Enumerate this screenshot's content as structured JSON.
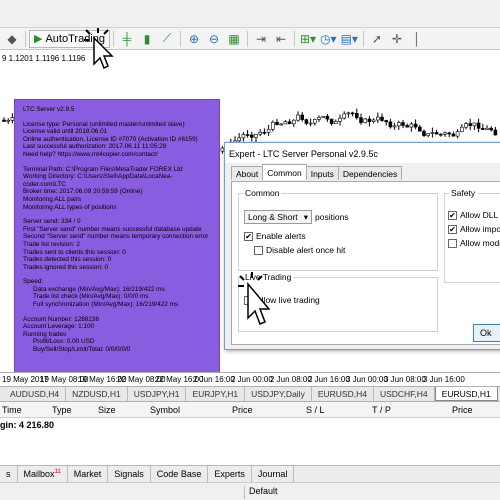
{
  "toolbar": {
    "autotrading_label": "AutoTrading",
    "icons": [
      "chart-icon",
      "autotrading-icon",
      "bar-chart-icon",
      "candle-chart-icon",
      "line-chart-icon",
      "zoom-in-icon",
      "zoom-out-icon",
      "tile-icon",
      "scroll-icon",
      "shift-icon",
      "indicators-icon",
      "periods-icon",
      "templates-icon",
      "crosshair-icon",
      "cursor-icon",
      "vertical-line-icon"
    ]
  },
  "chart": {
    "info_text": "9 1.1201 1.1196 1.1196",
    "candle_color": "#000000"
  },
  "ltc_box": {
    "background": "#8a5ce0",
    "lines": [
      "LTC Server v2.9.5",
      "",
      "License type: Personal (unlimited master/unlimited slave)",
      "License valid until 2018.06.01",
      "Online authentication. License ID #7070 (Activation ID #6159)",
      "Last successful authorization: 2017.06.11 11:05:28",
      "Need help? https://www.mt4copier.com/contact/",
      "",
      "Terminal Path: C:\\Program Files\\MetaTrader FOREX Ltd",
      "Working Directory: C:\\Users\\Steli\\AppData\\Local\\lea-coder.com\\LTC",
      "Broker time: 2017.06.09 20:59:59 (Online)",
      "Monitoring ALL pairs",
      "Monitoring ALL types of positions",
      "",
      "Server send: 334 / 0",
      "First \"Server send\" number means successful database update",
      "Second \"Server send\" number means temporary connection error",
      "Trade list revision: 2",
      "Trades sent to clients this session: 0",
      "Trades detected this session: 0",
      "Trades ignored this session: 0",
      "",
      "Speed:",
      "Data exchange (Min/Avg/Max): 16/219/422 ms",
      "Trade list check (Min/Avg/Max): 0/0/0 ms",
      "Full synchronization (Min/Avg/Max): 16/219/422 ms",
      "",
      "Account Number: 1288236",
      "Account Leverage: 1:100",
      "Running trades",
      "Profit/Loss: 0.00 USD",
      "Buy/Sell/Stop/Limit/Total: 0/0/0/0/0"
    ]
  },
  "time_axis": [
    "19 May 2017",
    "19 May 08:00",
    "19 May 16:00",
    "22 May 08:00",
    "22 May 16:00",
    "2 Jun 16:00",
    "2 Jun 00:00",
    "2 Jun 08:00",
    "2 Jun 16:00",
    "3 Jun 00:00",
    "3 Jun 08:00",
    "3 Jun 16:00"
  ],
  "chart_tabs": [
    {
      "label": "AUDUSD,H4",
      "active": false
    },
    {
      "label": "NZDUSD,H1",
      "active": false
    },
    {
      "label": "USDJPY,H1",
      "active": false
    },
    {
      "label": "EURJPY,H1",
      "active": false
    },
    {
      "label": "USDJPY,Daily",
      "active": false
    },
    {
      "label": "EURUSD,H4",
      "active": false
    },
    {
      "label": "USDCHF,H4",
      "active": false
    },
    {
      "label": "EURUSD,H1",
      "active": true
    }
  ],
  "terminal": {
    "columns": [
      "Time",
      "Type",
      "Size",
      "Symbol",
      "Price",
      "S / L",
      "T / P",
      "Price"
    ],
    "margin_text": "gin: 4 216.80"
  },
  "bottom_tabs": [
    {
      "label": "s",
      "badge": ""
    },
    {
      "label": "Mailbox",
      "badge": "11"
    },
    {
      "label": "Market",
      "badge": ""
    },
    {
      "label": "Signals",
      "badge": ""
    },
    {
      "label": "Code Base",
      "badge": ""
    },
    {
      "label": "Experts",
      "badge": ""
    },
    {
      "label": "Journal",
      "badge": ""
    }
  ],
  "status": {
    "profile": "Default"
  },
  "dialog": {
    "title": "Expert - LTC Server Personal v2.9.5c",
    "tabs": [
      {
        "label": "About",
        "active": false
      },
      {
        "label": "Common",
        "active": true
      },
      {
        "label": "Inputs",
        "active": false
      },
      {
        "label": "Dependencies",
        "active": false
      }
    ],
    "common_group": "Common",
    "positions_select": "Long & Short",
    "positions_label": "positions",
    "enable_alerts": "Enable alerts",
    "disable_alert": "Disable alert once hit",
    "live_group": "Live Trading",
    "allow_live": "Allow live trading",
    "safety_group": "Safety",
    "allow_dll": "Allow DLL imp",
    "allow_import": "Allow import of",
    "allow_modify": "Allow modifica",
    "ok_label": "Ok"
  }
}
